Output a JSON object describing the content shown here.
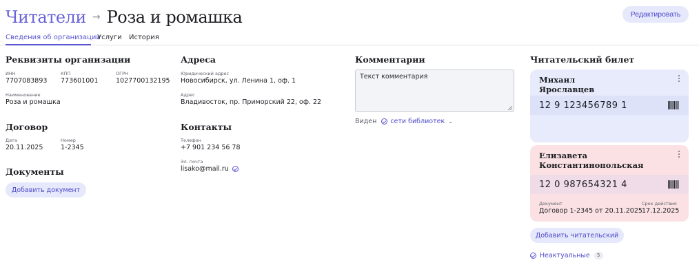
{
  "header": {
    "breadcrumb_root": "Читатели",
    "breadcrumb_arrow": "→",
    "title": "Роза и ромашка",
    "edit_label": "Редактировать"
  },
  "tabs": [
    {
      "label": "Сведения об организации",
      "active": true
    },
    {
      "label": "Услуги",
      "active": false
    },
    {
      "label": "История",
      "active": false
    }
  ],
  "requisites": {
    "title": "Реквизиты организации",
    "inn_label": "ИНН",
    "inn": "7707083893",
    "kpp_label": "КПП",
    "kpp": "773601001",
    "ogrn_label": "ОГРН",
    "ogrn": "1027700132195",
    "name_label": "Наименование",
    "name": "Роза и ромашка"
  },
  "contract": {
    "title": "Договор",
    "date_label": "Дата",
    "date": "20.11.2025",
    "number_label": "Номер",
    "number": "1-2345"
  },
  "documents": {
    "title": "Документы",
    "add_label": "Добавить документ"
  },
  "addresses": {
    "title": "Адреса",
    "legal_label": "Юридический адрес",
    "legal": "Новосибирск, ул. Ленина 1, оф. 1",
    "address_label": "Адрес",
    "address": "Владивосток, пр. Приморский 22, оф. 22"
  },
  "contacts": {
    "title": "Контакты",
    "phone_label": "Телефон",
    "phone": "+7 901 234 56 78",
    "email_label": "Эл. почта",
    "email": "lisako@mail.ru"
  },
  "comments": {
    "title": "Комментарии",
    "text": "Текст комментария",
    "visible_label": "Виден",
    "visible_value": "сети библиотек",
    "dropdown_glyph": "⌄"
  },
  "library_card": {
    "title": "Читательский билет",
    "cards": [
      {
        "name_line1": "Михаил",
        "name_line2": "Ярославцев",
        "number": "12 9 123456789 1",
        "color": "#e7ebfb"
      },
      {
        "name_line1": "Елизавета",
        "name_line2": "Константинопольская",
        "number": "12 0 987654321 4",
        "doc_label": "Документ",
        "doc": "Договор 1-2345 от 20.11.2025",
        "expiry_label": "Срок действия",
        "expiry": "17.12.2025",
        "color": "#fbe1e3"
      }
    ],
    "add_label": "Добавить читательский",
    "inactive_label": "Неактуальные",
    "inactive_count": "5"
  },
  "colors": {
    "accent": "#5a55d2",
    "button_bg": "#e6e8fb"
  }
}
